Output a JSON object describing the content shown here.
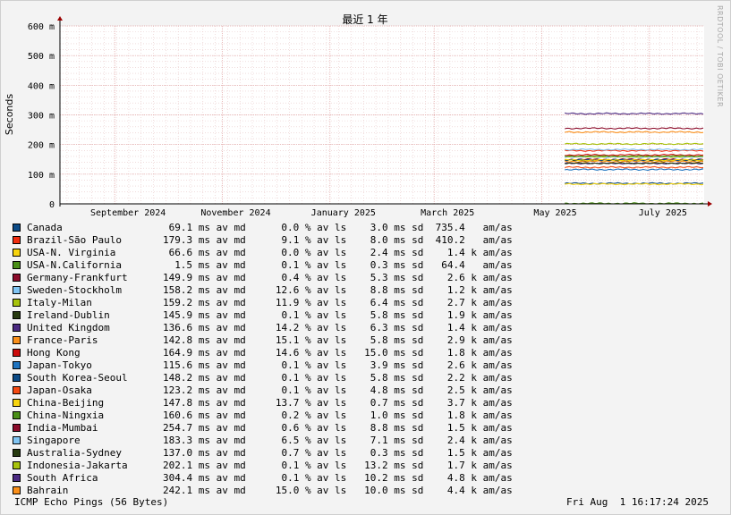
{
  "chart_data": {
    "type": "line",
    "title": "最近 1 年",
    "ylabel": "Seconds",
    "ylim": [
      0,
      0.6
    ],
    "y_ticks": [
      "0",
      "100 m",
      "200 m",
      "300 m",
      "400 m",
      "500 m",
      "600 m"
    ],
    "y_tick_values": [
      0,
      0.1,
      0.2,
      0.3,
      0.4,
      0.5,
      0.6
    ],
    "x_ticks": [
      "September 2024",
      "November 2024",
      "January 2025",
      "March 2025",
      "May 2025",
      "July 2025"
    ],
    "x_tick_dates": [
      "2024-09-01",
      "2024-11-01",
      "2025-01-01",
      "2025-03-01",
      "2025-05-01",
      "2025-07-01"
    ],
    "xlim": [
      "2024-08-01",
      "2025-08-01"
    ],
    "data_start": "2025-05-14",
    "grid": true,
    "series": [
      {
        "name": "Canada",
        "color": "#0b4a86",
        "median_s": 0.0691,
        "loss": "0.0 %",
        "std": "3.0 ms",
        "am": "735.4"
      },
      {
        "name": "Brazil-São Paulo",
        "color": "#f02e11",
        "median_s": 0.1793,
        "loss": "9.1 %",
        "std": "8.0 ms",
        "am": "410.2"
      },
      {
        "name": "USA-N. Virginia",
        "color": "#f7d40e",
        "median_s": 0.0666,
        "loss": "0.0 %",
        "std": "2.4 ms",
        "am": "1.4 k"
      },
      {
        "name": "USA-N.California",
        "color": "#4a8f17",
        "median_s": 0.0015,
        "loss": "0.1 %",
        "std": "0.3 ms",
        "am": "64.4"
      },
      {
        "name": "Germany-Frankfurt",
        "color": "#8b0b2a",
        "median_s": 0.1499,
        "loss": "0.4 %",
        "std": "5.3 ms",
        "am": "2.6 k"
      },
      {
        "name": "Sweden-Stockholm",
        "color": "#80c4f2",
        "median_s": 0.1582,
        "loss": "12.6 %",
        "std": "8.8 ms",
        "am": "1.2 k"
      },
      {
        "name": "Italy-Milan",
        "color": "#a8c40c",
        "median_s": 0.1592,
        "loss": "11.9 %",
        "std": "6.4 ms",
        "am": "2.7 k"
      },
      {
        "name": "Ireland-Dublin",
        "color": "#273a10",
        "median_s": 0.1459,
        "loss": "0.1 %",
        "std": "5.8 ms",
        "am": "1.9 k"
      },
      {
        "name": "United Kingdom",
        "color": "#4b2a82",
        "median_s": 0.1366,
        "loss": "14.2 %",
        "std": "6.3 ms",
        "am": "1.4 k"
      },
      {
        "name": "France-Paris",
        "color": "#fa8f1a",
        "median_s": 0.1428,
        "loss": "15.1 %",
        "std": "5.8 ms",
        "am": "2.9 k"
      },
      {
        "name": "Hong Kong",
        "color": "#cc0c0c",
        "median_s": 0.1649,
        "loss": "14.6 %",
        "std": "15.0 ms",
        "am": "1.8 k"
      },
      {
        "name": "Japan-Tokyo",
        "color": "#1f74c0",
        "median_s": 0.1156,
        "loss": "0.1 %",
        "std": "3.9 ms",
        "am": "2.6 k"
      },
      {
        "name": "South Korea-Seoul",
        "color": "#0b4a86",
        "median_s": 0.1482,
        "loss": "0.1 %",
        "std": "5.8 ms",
        "am": "2.2 k"
      },
      {
        "name": "Japan-Osaka",
        "color": "#f54a12",
        "median_s": 0.1232,
        "loss": "0.1 %",
        "std": "4.8 ms",
        "am": "2.5 k"
      },
      {
        "name": "China-Beijing",
        "color": "#f7d40e",
        "median_s": 0.1478,
        "loss": "13.7 %",
        "std": "0.7 ms",
        "am": "3.7 k"
      },
      {
        "name": "China-Ningxia",
        "color": "#4a8f17",
        "median_s": 0.1606,
        "loss": "0.2 %",
        "std": "1.0 ms",
        "am": "1.8 k"
      },
      {
        "name": "India-Mumbai",
        "color": "#8b0b2a",
        "median_s": 0.2547,
        "loss": "0.6 %",
        "std": "8.8 ms",
        "am": "1.5 k"
      },
      {
        "name": "Singapore",
        "color": "#80c4f2",
        "median_s": 0.1833,
        "loss": "6.5 %",
        "std": "7.1 ms",
        "am": "2.4 k"
      },
      {
        "name": "Australia-Sydney",
        "color": "#273a10",
        "median_s": 0.137,
        "loss": "0.7 %",
        "std": "0.3 ms",
        "am": "1.5 k"
      },
      {
        "name": "Indonesia-Jakarta",
        "color": "#a8c40c",
        "median_s": 0.2021,
        "loss": "0.1 %",
        "std": "13.2 ms",
        "am": "1.7 k"
      },
      {
        "name": "South Africa",
        "color": "#4b2a82",
        "median_s": 0.3044,
        "loss": "0.1 %",
        "std": "10.2 ms",
        "am": "4.8 k"
      },
      {
        "name": "Bahrain",
        "color": "#fa8f1a",
        "median_s": 0.2421,
        "loss": "15.0 %",
        "std": "10.0 ms",
        "am": "4.4 k"
      }
    ]
  },
  "legend": {
    "rows": [
      {
        "name": "Canada",
        "stats": "69.1 ms av md      0.0 % av ls    3.0 ms sd  735.4   am/as"
      },
      {
        "name": "Brazil-São Paulo",
        "stats": "179.3 ms av md      9.1 % av ls    8.0 ms sd  410.2   am/as"
      },
      {
        "name": "USA-N. Virginia",
        "stats": "66.6 ms av md      0.0 % av ls    2.4 ms sd    1.4 k am/as"
      },
      {
        "name": "USA-N.California",
        "stats": "1.5 ms av md      0.1 % av ls    0.3 ms sd   64.4   am/as"
      },
      {
        "name": "Germany-Frankfurt",
        "stats": "149.9 ms av md      0.4 % av ls    5.3 ms sd    2.6 k am/as"
      },
      {
        "name": "Sweden-Stockholm",
        "stats": "158.2 ms av md     12.6 % av ls    8.8 ms sd    1.2 k am/as"
      },
      {
        "name": "Italy-Milan",
        "stats": "159.2 ms av md     11.9 % av ls    6.4 ms sd    2.7 k am/as"
      },
      {
        "name": "Ireland-Dublin",
        "stats": "145.9 ms av md      0.1 % av ls    5.8 ms sd    1.9 k am/as"
      },
      {
        "name": "United Kingdom",
        "stats": "136.6 ms av md     14.2 % av ls    6.3 ms sd    1.4 k am/as"
      },
      {
        "name": "France-Paris",
        "stats": "142.8 ms av md     15.1 % av ls    5.8 ms sd    2.9 k am/as"
      },
      {
        "name": "Hong Kong",
        "stats": "164.9 ms av md     14.6 % av ls   15.0 ms sd    1.8 k am/as"
      },
      {
        "name": "Japan-Tokyo",
        "stats": "115.6 ms av md      0.1 % av ls    3.9 ms sd    2.6 k am/as"
      },
      {
        "name": "South Korea-Seoul",
        "stats": "148.2 ms av md      0.1 % av ls    5.8 ms sd    2.2 k am/as"
      },
      {
        "name": "Japan-Osaka",
        "stats": "123.2 ms av md      0.1 % av ls    4.8 ms sd    2.5 k am/as"
      },
      {
        "name": "China-Beijing",
        "stats": "147.8 ms av md     13.7 % av ls    0.7 ms sd    3.7 k am/as"
      },
      {
        "name": "China-Ningxia",
        "stats": "160.6 ms av md      0.2 % av ls    1.0 ms sd    1.8 k am/as"
      },
      {
        "name": "India-Mumbai",
        "stats": "254.7 ms av md      0.6 % av ls    8.8 ms sd    1.5 k am/as"
      },
      {
        "name": "Singapore",
        "stats": "183.3 ms av md      6.5 % av ls    7.1 ms sd    2.4 k am/as"
      },
      {
        "name": "Australia-Sydney",
        "stats": "137.0 ms av md      0.7 % av ls    0.3 ms sd    1.5 k am/as"
      },
      {
        "name": "Indonesia-Jakarta",
        "stats": "202.1 ms av md      0.1 % av ls   13.2 ms sd    1.7 k am/as"
      },
      {
        "name": "South Africa",
        "stats": "304.4 ms av md      0.1 % av ls   10.2 ms sd    4.8 k am/as"
      },
      {
        "name": "Bahrain",
        "stats": "242.1 ms av md     15.0 % av ls   10.0 ms sd    4.4 k am/as"
      }
    ]
  },
  "footer": {
    "left": "ICMP Echo Pings (56 Bytes)",
    "right": "Fri Aug  1 16:17:24 2025"
  },
  "watermark": "RRDTOOL / TOBI OETIKER",
  "colors": {
    "grid_minor": "#e8c8c8",
    "grid_major": "#e0a0a0",
    "axis": "#000000",
    "arrow": "#9b0000",
    "background": "#f3f3f3",
    "plot_bg": "#ffffff"
  }
}
